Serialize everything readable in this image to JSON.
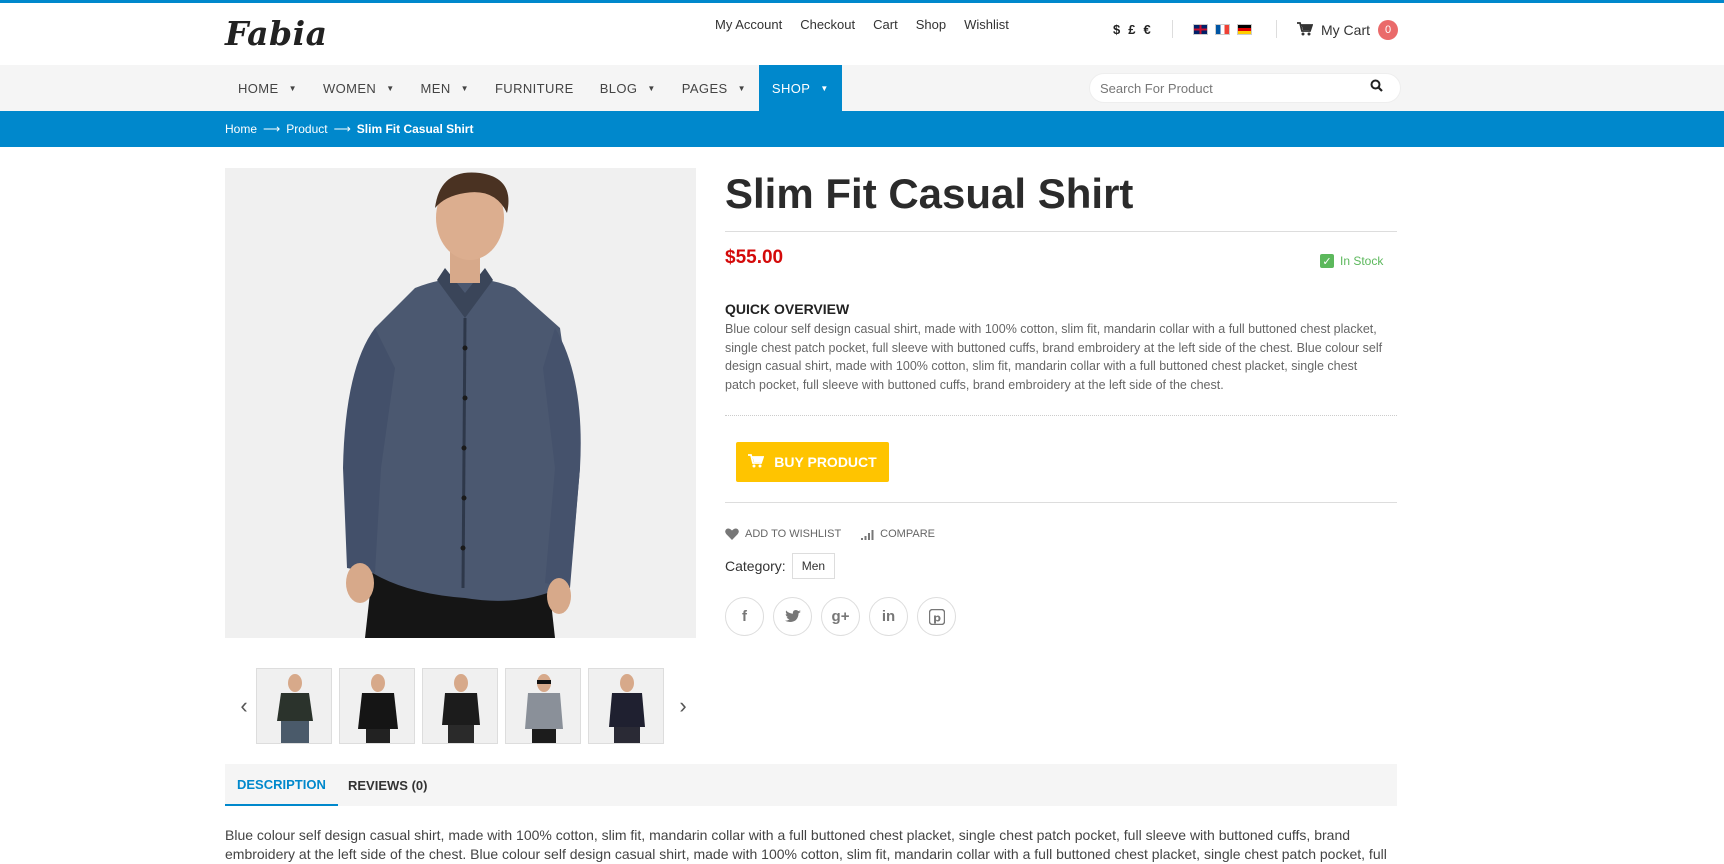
{
  "brand": {
    "logo": "Fabia"
  },
  "toplinks": [
    "My Account",
    "Checkout",
    "Cart",
    "Shop",
    "Wishlist"
  ],
  "currencies": [
    "$",
    "£",
    "€"
  ],
  "languages": [
    "English",
    "French",
    "German"
  ],
  "cart": {
    "label": "My Cart",
    "count": "0"
  },
  "nav": {
    "items": [
      {
        "label": "HOME",
        "dropdown": true
      },
      {
        "label": "WOMEN",
        "dropdown": true
      },
      {
        "label": "MEN",
        "dropdown": true
      },
      {
        "label": "FURNITURE",
        "dropdown": false
      },
      {
        "label": "BLOG",
        "dropdown": true
      },
      {
        "label": "PAGES",
        "dropdown": true
      },
      {
        "label": "SHOP",
        "dropdown": true,
        "active": true
      }
    ]
  },
  "search": {
    "placeholder": "Search For Product"
  },
  "breadcrumb": {
    "home": "Home",
    "sep": "⟶",
    "product": "Product",
    "current": "Slim Fit Casual Shirt"
  },
  "product": {
    "title": "Slim Fit Casual Shirt",
    "price": "$55.00",
    "stock": "In Stock",
    "overview_heading": "QUICK OVERVIEW",
    "overview_text": "Blue colour self design casual shirt, made with 100% cotton, slim fit, mandarin collar with a full buttoned chest placket, single chest patch pocket, full sleeve with buttoned cuffs, brand embroidery at the left side of the chest. Blue colour self design casual shirt, made with 100% cotton, slim fit, mandarin collar with a full buttoned chest placket, single chest patch pocket, full sleeve with buttoned cuffs, brand embroidery at the left side of the chest.",
    "buy_label": "BUY PRODUCT",
    "wishlist_label": "ADD TO WISHLIST",
    "compare_label": "COMPARE",
    "category_label": "Category:",
    "category_value": "Men"
  },
  "socials": [
    "f",
    "t",
    "g+",
    "in",
    "p"
  ],
  "thumbnails": [
    {
      "shirt": "#2b332c",
      "pants": "#4a5a6a"
    },
    {
      "shirt": "#151515",
      "pants": "#222"
    },
    {
      "shirt": "#1c1c1c",
      "pants": "#2a2a2a"
    },
    {
      "shirt": "#8a9099",
      "pants": "#1c1c1c"
    },
    {
      "shirt": "#1f2030",
      "pants": "#2a2a35"
    }
  ],
  "tabs": {
    "description": "DESCRIPTION",
    "reviews": "REVIEWS (0)"
  },
  "description_text": "Blue colour self design casual shirt, made with 100% cotton, slim fit, mandarin collar with a full buttoned chest placket, single chest patch pocket, full sleeve with buttoned cuffs, brand embroidery at the left side of the chest. Blue colour self design casual shirt, made with 100% cotton, slim fit, mandarin collar with a full buttoned chest placket, single chest patch pocket, full",
  "colors": {
    "accent": "#0088cc",
    "price": "#d40a0a",
    "buy": "#ffc400",
    "stock": "#5cb85c",
    "badge": "#ea6a6a"
  }
}
